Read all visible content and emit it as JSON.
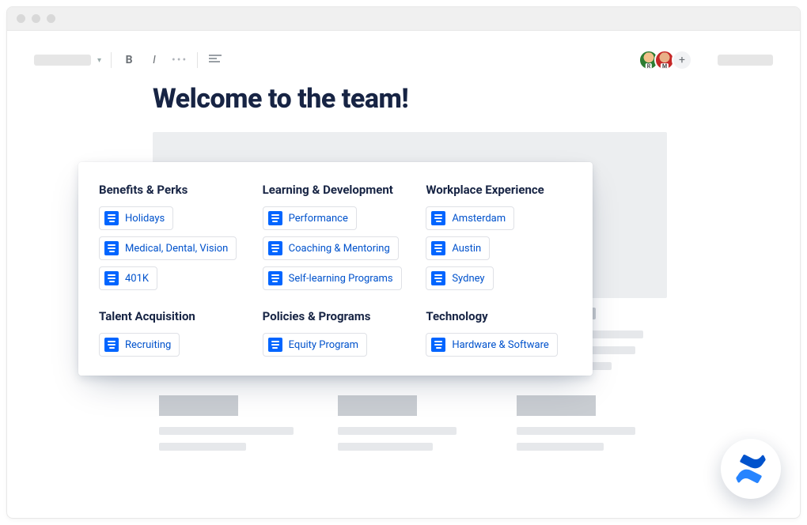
{
  "page": {
    "title": "Welcome to the team!"
  },
  "avatars": {
    "a1_badge": "R",
    "a2_badge": "M",
    "add_label": "+"
  },
  "card": {
    "columns": [
      {
        "title": "Benefits & Perks",
        "items": [
          "Holidays",
          "Medical, Dental, Vision",
          "401K"
        ]
      },
      {
        "title": "Learning & Development",
        "items": [
          "Performance",
          "Coaching & Mentoring",
          "Self-learning Programs"
        ]
      },
      {
        "title": "Workplace Experience",
        "items": [
          "Amsterdam",
          "Austin",
          "Sydney"
        ]
      },
      {
        "title": "Talent Acquisition",
        "items": [
          "Recruiting"
        ]
      },
      {
        "title": "Policies & Programs",
        "items": [
          "Equity Program"
        ]
      },
      {
        "title": "Technology",
        "items": [
          "Hardware & Software"
        ]
      }
    ]
  },
  "icons": {
    "document": "document-icon",
    "confluence": "confluence-logo"
  }
}
